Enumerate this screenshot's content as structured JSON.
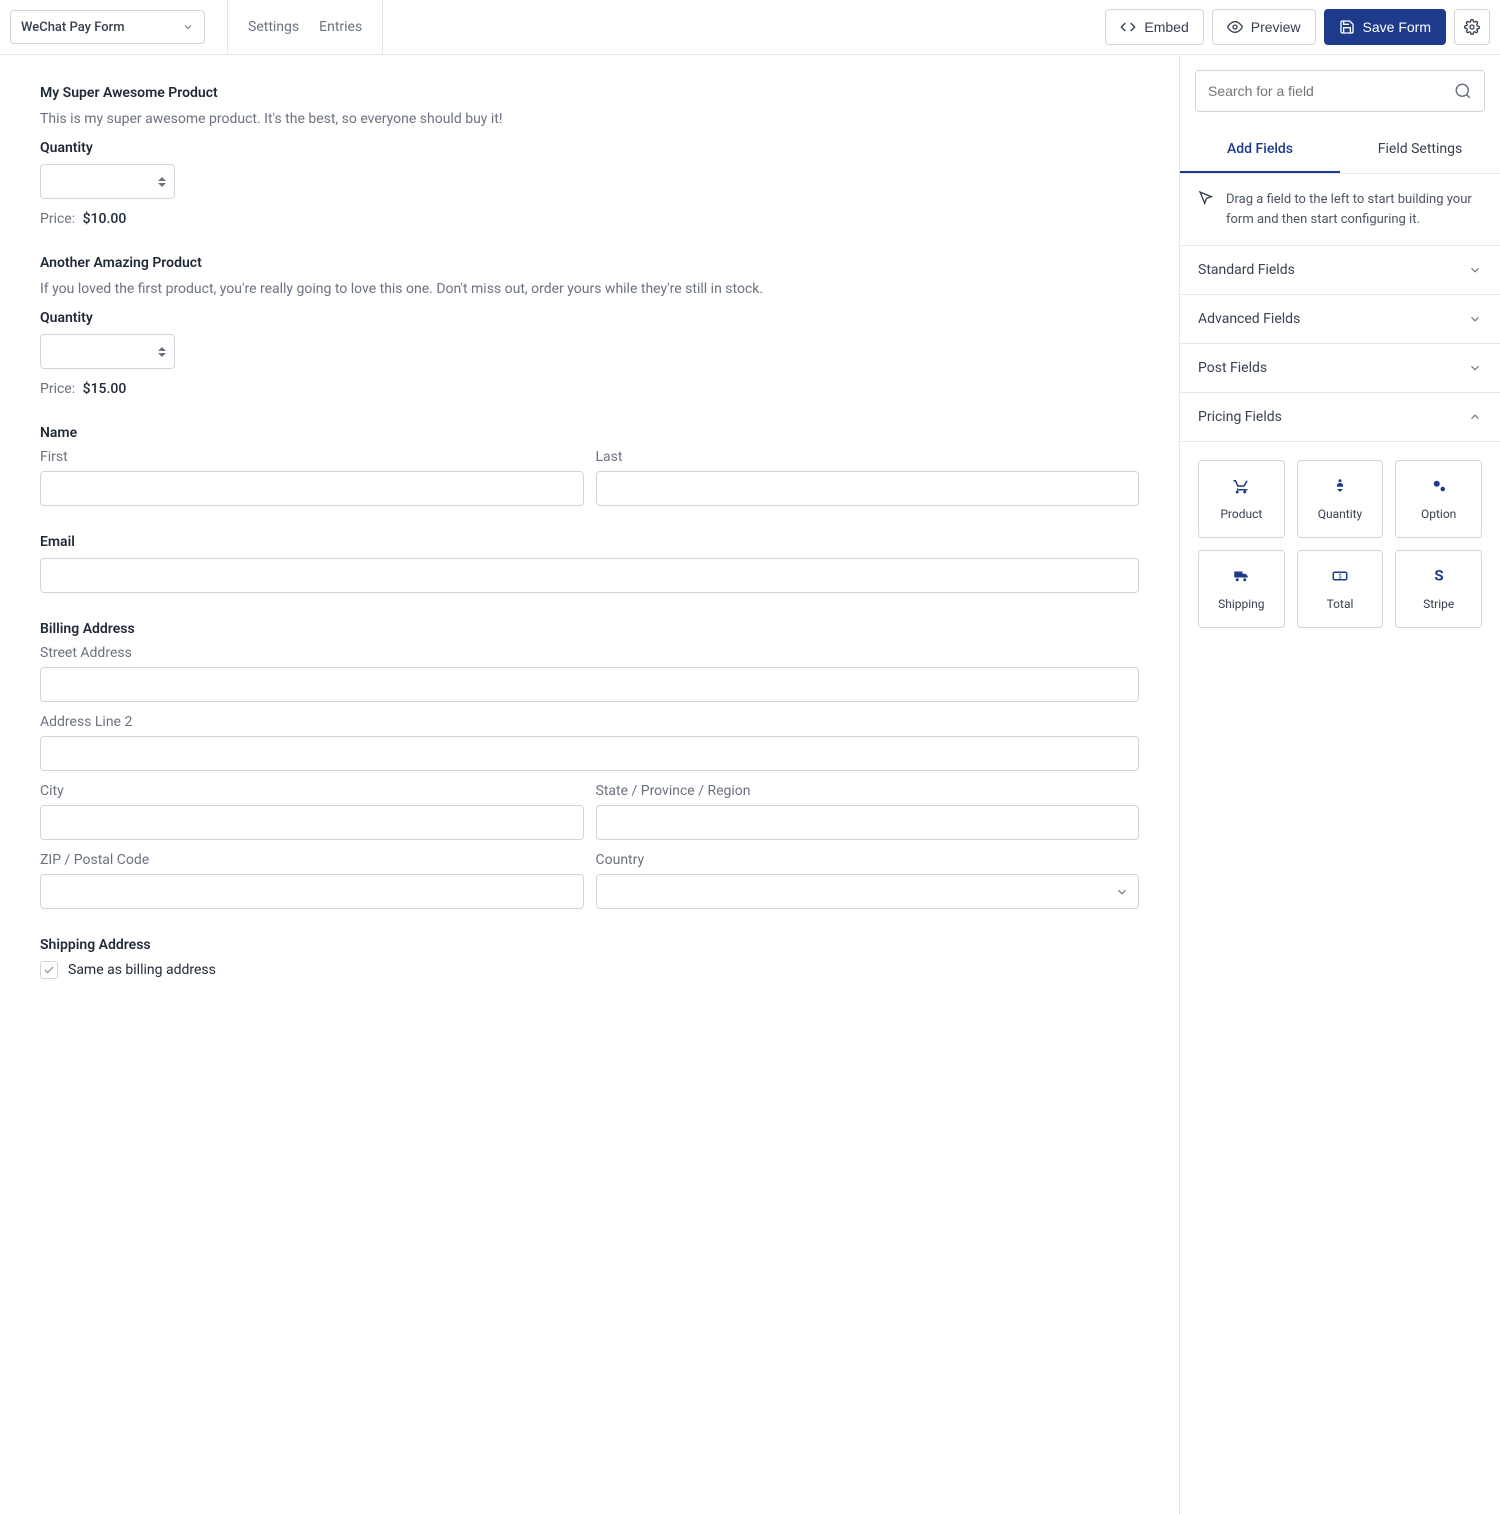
{
  "header": {
    "form_name": "WeChat Pay Form",
    "tabs": [
      "Settings",
      "Entries"
    ],
    "embed": "Embed",
    "preview": "Preview",
    "save": "Save Form"
  },
  "form": {
    "products": [
      {
        "title": "My Super Awesome Product",
        "desc": "This is my super awesome product. It's the best, so everyone should buy it!",
        "qty_label": "Quantity",
        "price_label": "Price:",
        "price": "$10.00"
      },
      {
        "title": "Another Amazing Product",
        "desc": "If you loved the first product, you're really going to love this one. Don't miss out, order yours while they're still in stock.",
        "qty_label": "Quantity",
        "price_label": "Price:",
        "price": "$15.00"
      }
    ],
    "name": {
      "label": "Name",
      "first": "First",
      "last": "Last"
    },
    "email": {
      "label": "Email"
    },
    "billing": {
      "label": "Billing Address",
      "street": "Street Address",
      "line2": "Address Line 2",
      "city": "City",
      "state": "State / Province / Region",
      "zip": "ZIP / Postal Code",
      "country": "Country"
    },
    "shipping": {
      "label": "Shipping Address",
      "same": "Same as billing address"
    }
  },
  "sidebar": {
    "search_placeholder": "Search for a field",
    "tabs": [
      "Add Fields",
      "Field Settings"
    ],
    "hint": "Drag a field to the left to start building your form and then start configuring it.",
    "groups": {
      "standard": "Standard Fields",
      "advanced": "Advanced Fields",
      "post": "Post Fields",
      "pricing": "Pricing Fields"
    },
    "pricing_fields": [
      "Product",
      "Quantity",
      "Option",
      "Shipping",
      "Total",
      "Stripe"
    ]
  }
}
